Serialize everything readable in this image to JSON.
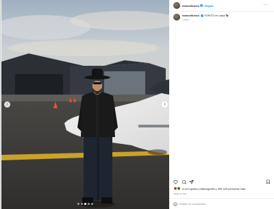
{
  "post": {
    "username": "manuelturizo",
    "verified_icon": "verified-badge-icon",
    "separator": "•",
    "follow_label": "Seguir",
    "more_icon": "more-options-icon",
    "more_glyph": "···",
    "caption_text": "TORITO en casa 🐂",
    "caption_time": "1 sem",
    "likes_text": "A ceci guilla y rafaeagui4i8 y 599.349 personas más",
    "post_time": "Hace un día",
    "comment_placeholder": "Añade un comentario...",
    "icons": [
      "heart-icon",
      "comment-icon",
      "share-icon",
      "save-icon",
      "emoji-icon",
      "chevron-left-icon",
      "chevron-right-icon"
    ],
    "carousel_prev": "‹",
    "carousel_next": "›",
    "carousel_slides": 5,
    "carousel_active": 2
  },
  "colors": {
    "link_blue": "#0095f6",
    "verified_blue": "#3897f0",
    "muted_text": "#8e8e8e"
  }
}
